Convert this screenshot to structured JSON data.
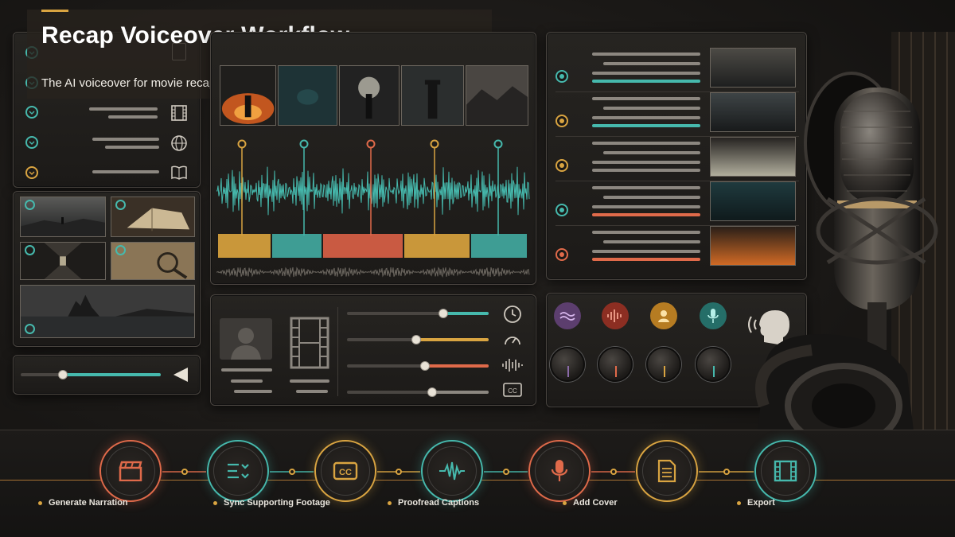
{
  "header": {
    "title": "Recap Voiceover Workflow",
    "subtitle": "The AI voiceover for movie recaps workflow, step by step"
  },
  "left_panel": {
    "rows": [
      {
        "icon": "document-icon",
        "status": "done",
        "color": "#46b9ad"
      },
      {
        "icon": "document-icon",
        "status": "done",
        "color": "#46b9ad"
      },
      {
        "icon": "film-icon",
        "status": "done",
        "color": "#46b9ad"
      },
      {
        "icon": "globe-icon",
        "status": "done",
        "color": "#46b9ad"
      },
      {
        "icon": "book-icon",
        "status": "pending",
        "color": "#d9a441"
      }
    ]
  },
  "media_grid": {
    "thumbnails": [
      "lone-figure-landscape",
      "open-book",
      "dark-corridor",
      "magnifier-map",
      "island-castle"
    ]
  },
  "playback": {
    "progress": 0.3
  },
  "timeline": {
    "markers": [
      {
        "color": "#d9a441"
      },
      {
        "color": "#46b9ad"
      },
      {
        "color": "#e06a4a"
      },
      {
        "color": "#d9a441"
      },
      {
        "color": "#46b9ad"
      }
    ],
    "segments": [
      {
        "color": "#c9973a"
      },
      {
        "color": "#3e9d94"
      },
      {
        "color": "#c95a42"
      },
      {
        "color": "#c9973a"
      },
      {
        "color": "#3e9d94"
      }
    ]
  },
  "scene_list": {
    "items": [
      {
        "color": "#46b9ad",
        "accent": "#46b9ad"
      },
      {
        "color": "#d9a441",
        "accent": "#46b9ad"
      },
      {
        "color": "#d9a441",
        "accent": "#8c8780"
      },
      {
        "color": "#46b9ad",
        "accent": "#e06a4a"
      },
      {
        "color": "#e06a4a",
        "accent": "#e06a4a"
      }
    ]
  },
  "mixer": {
    "sliders": [
      {
        "level": 0.68,
        "color": "#46b9ad",
        "icon": "clock-icon"
      },
      {
        "level": 0.49,
        "color": "#d9a441",
        "icon": "gauge-icon"
      },
      {
        "level": 0.55,
        "color": "#e06a4a",
        "icon": "waveform-icon"
      },
      {
        "level": 0.6,
        "color": "#8c8780",
        "icon": "captions-icon"
      }
    ]
  },
  "voice_panel": {
    "channels": [
      {
        "icon": "wave-icon",
        "color": "#8a6aa8"
      },
      {
        "icon": "audio-wave-icon",
        "color": "#e06a4a"
      },
      {
        "icon": "person-icon",
        "color": "#d9a441"
      },
      {
        "icon": "microphone-icon",
        "color": "#46b9ad"
      }
    ]
  },
  "workflow": {
    "steps": [
      {
        "label": "Generate Narration",
        "icon": "clapperboard-icon",
        "color": "#e06a4a"
      },
      {
        "label": "",
        "icon": "list-sort-icon",
        "color": "#46b9ad"
      },
      {
        "label": "Sync Supporting Footage",
        "icon": "captions-icon",
        "color": "#d9a441"
      },
      {
        "label": "",
        "icon": "waveform-icon",
        "color": "#46b9ad"
      },
      {
        "label": "Proofread Captions",
        "icon": "microphone-icon",
        "color": "#e06a4a"
      },
      {
        "label": "",
        "icon": "document-icon",
        "color": "#d9a441"
      },
      {
        "label": "Add Cover",
        "icon": "film-icon",
        "color": "#46b9ad"
      }
    ],
    "labels": [
      "Generate Narration",
      "Sync Supporting Footage",
      "Proofread Captions",
      "Add Cover",
      "Export"
    ]
  }
}
